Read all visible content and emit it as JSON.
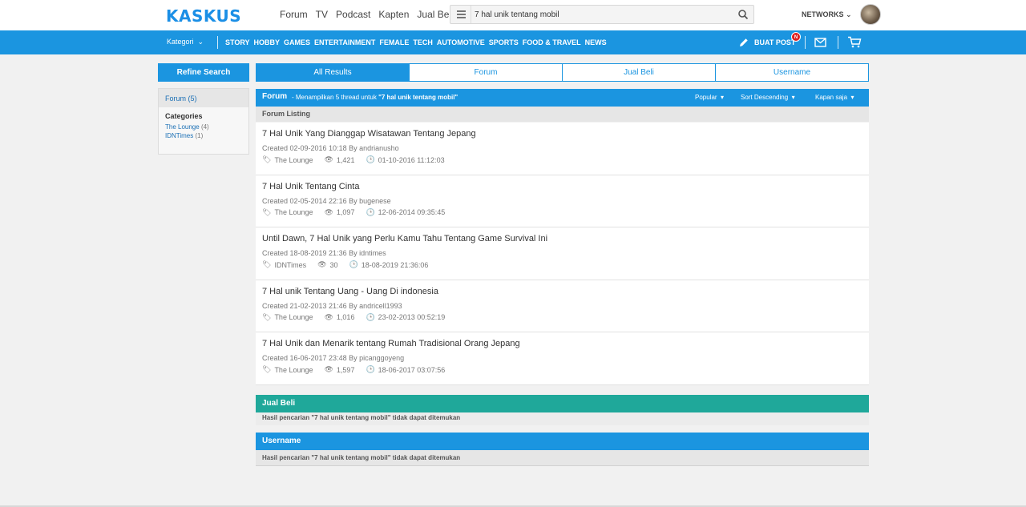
{
  "header": {
    "logo": "KASKUS",
    "nav": [
      "Forum",
      "TV",
      "Podcast",
      "Kapten",
      "Jual Beli"
    ],
    "search_value": "7 hal unik tentang mobil",
    "networks": "NETWORKS"
  },
  "catbar": {
    "kategori": "Kategori",
    "categories": [
      "STORY",
      "HOBBY",
      "GAMES",
      "ENTERTAINMENT",
      "FEMALE",
      "TECH",
      "AUTOMOTIVE",
      "SPORTS",
      "FOOD & TRAVEL",
      "NEWS"
    ],
    "buat_post": "BUAT POST",
    "badge": "N"
  },
  "sidebar": {
    "refine": "Refine Search",
    "forum_count": "Forum (5)",
    "categories_title": "Categories",
    "categories": [
      {
        "name": "The Lounge",
        "count": "(4)"
      },
      {
        "name": "IDNTimes",
        "count": "(1)"
      }
    ]
  },
  "tabs": [
    "All Results",
    "Forum",
    "Jual Beli",
    "Username"
  ],
  "forum": {
    "title": "Forum",
    "desc_prefix": "- Menampilkan 5 thread untuk",
    "desc_query": "\"7 hal unik tentang mobil\"",
    "sort_popular": "Popular",
    "sort_order": "Sort Descending",
    "sort_time": "Kapan saja",
    "listing_label": "Forum Listing",
    "threads": [
      {
        "title": "7 Hal Unik Yang Dianggap Wisatawan Tentang Jepang",
        "created": "Created 02-09-2016 10:18 By andrianusho",
        "category": "The Lounge",
        "views": "1,421",
        "last": "01-10-2016 11:12:03"
      },
      {
        "title": "7 Hal Unik Tentang Cinta",
        "created": "Created 02-05-2014 22:16 By bugenese",
        "category": "The Lounge",
        "views": "1,097",
        "last": "12-06-2014 09:35:45"
      },
      {
        "title": "Until Dawn, 7 Hal Unik yang Perlu Kamu Tahu Tentang Game Survival Ini",
        "created": "Created 18-08-2019 21:36 By idntimes",
        "category": "IDNTimes",
        "views": "30",
        "last": "18-08-2019 21:36:06"
      },
      {
        "title": "7 Hal unik Tentang Uang - Uang Di indonesia",
        "created": "Created 21-02-2013 21:46 By andricell1993",
        "category": "The Lounge",
        "views": "1,016",
        "last": "23-02-2013 00:52:19"
      },
      {
        "title": "7 Hal Unik dan Menarik tentang Rumah Tradisional Orang Jepang",
        "created": "Created 16-06-2017 23:48 By picanggoyeng",
        "category": "The Lounge",
        "views": "1,597",
        "last": "18-06-2017 03:07:56"
      }
    ]
  },
  "jualbeli": {
    "title": "Jual Beli",
    "message": "Hasil pencarian \"7 hal unik tentang mobil\" tidak dapat ditemukan"
  },
  "username": {
    "title": "Username",
    "message": "Hasil pencarian \"7 hal unik tentang mobil\" tidak dapat ditemukan"
  },
  "colors": {
    "brand_blue": "#1b95e0",
    "jualbeli_green": "#1fa89a",
    "badge_red": "#e01e1e"
  }
}
